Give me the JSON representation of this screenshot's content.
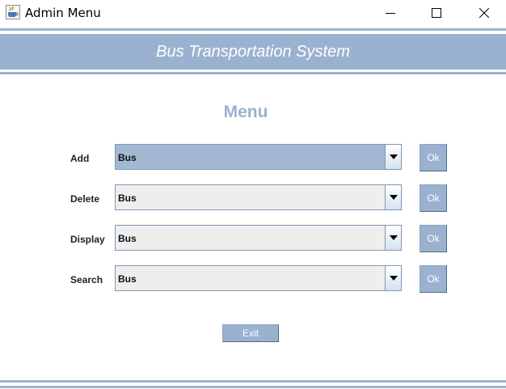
{
  "window": {
    "title": "Admin Menu"
  },
  "banner": {
    "title": "Bus Transportation System"
  },
  "menu": {
    "title": "Menu",
    "rows": [
      {
        "label": "Add",
        "value": "Bus",
        "ok": "Ok"
      },
      {
        "label": "Delete",
        "value": "Bus",
        "ok": "Ok"
      },
      {
        "label": "Display",
        "value": "Bus",
        "ok": "Ok"
      },
      {
        "label": "Search",
        "value": "Bus",
        "ok": "Ok"
      }
    ]
  },
  "exit_label": "Exit",
  "colors": {
    "accent": "#9ab2cf",
    "active_combo": "#a3b8d2",
    "combo_bg": "#eeeeee"
  },
  "icons": {
    "app": "java-coffee-icon",
    "minimize": "minimize-icon",
    "maximize": "maximize-icon",
    "close": "close-icon",
    "dropdown": "chevron-down-icon"
  }
}
